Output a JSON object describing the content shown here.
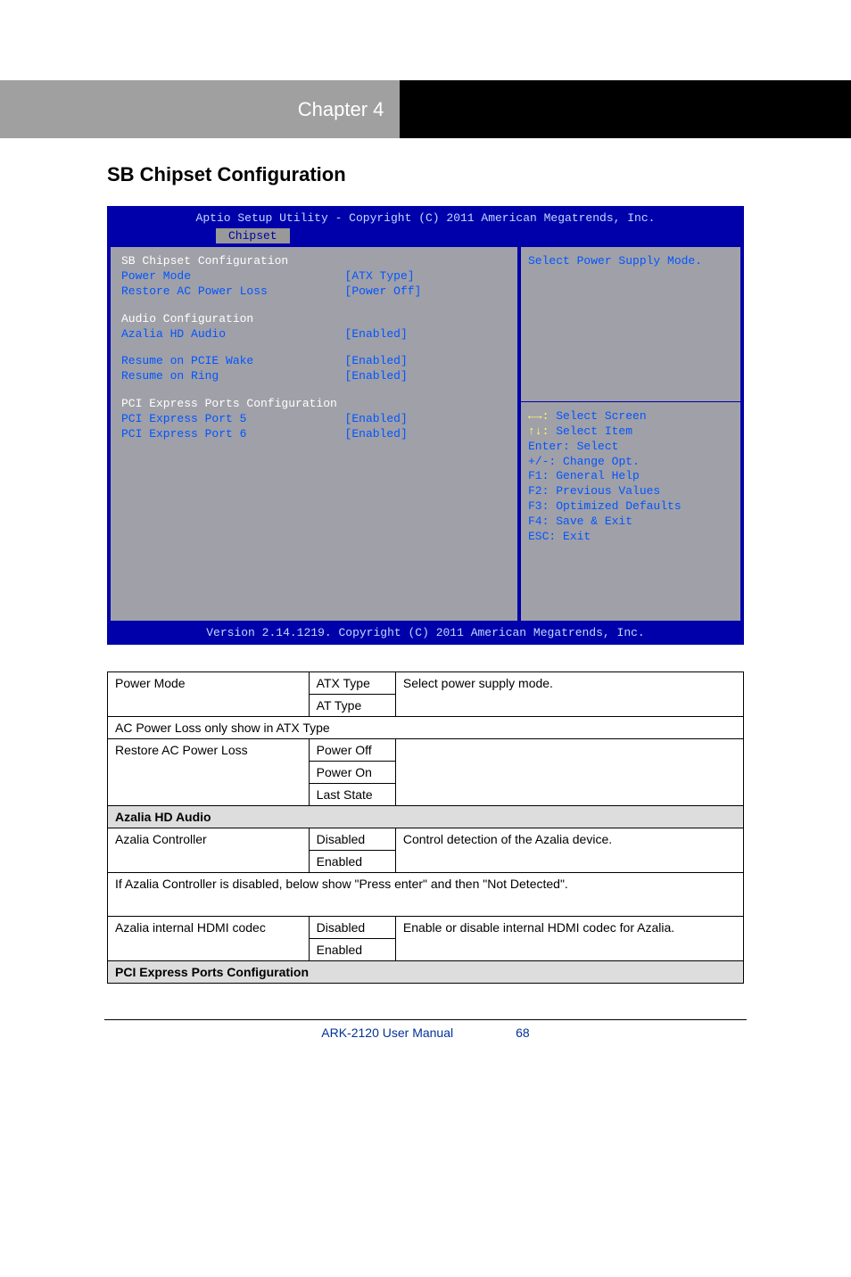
{
  "header": {
    "chapter": "Chapter 4"
  },
  "title": "SB Chipset Configuration",
  "bios": {
    "topline": "Aptio Setup Utility - Copyright (C) 2011 American Megatrends, Inc.",
    "tab": "Chipset",
    "sections": {
      "sb": "SB Chipset Configuration",
      "audio": "Audio Configuration",
      "pci": "PCI Express Ports Configuration"
    },
    "items": [
      {
        "label": "Power Mode",
        "value": "[ATX Type]"
      },
      {
        "label": "Restore AC Power Loss",
        "value": "[Power Off]"
      },
      {
        "label": "Azalia HD Audio",
        "value": "[Enabled]"
      },
      {
        "label": "Resume on PCIE Wake",
        "value": "[Enabled]"
      },
      {
        "label": "Resume on Ring",
        "value": "[Enabled]"
      },
      {
        "label": "PCI Express Port 5",
        "value": "[Enabled]"
      },
      {
        "label": "PCI Express Port 6",
        "value": "[Enabled]"
      }
    ],
    "help": "Select Power Supply Mode.",
    "keys": [
      {
        "k": "←→:",
        "t": "Select Screen"
      },
      {
        "k": "↑↓:",
        "t": "Select Item"
      },
      {
        "k": "Enter:",
        "t": "Select"
      },
      {
        "k": "+/-:",
        "t": "Change Opt."
      },
      {
        "k": "F1:",
        "t": "General Help"
      },
      {
        "k": "F2:",
        "t": "Previous Values"
      },
      {
        "k": "F3:",
        "t": "Optimized Defaults"
      },
      {
        "k": "F4:",
        "t": "Save & Exit"
      },
      {
        "k": "ESC:",
        "t": "Exit"
      }
    ],
    "bottomline": "Version 2.14.1219. Copyright (C) 2011 American Megatrends, Inc."
  },
  "table": [
    {
      "item": "Power Mode",
      "options": [
        "ATX Type",
        "AT Type"
      ],
      "desc": "Select power supply mode."
    },
    {
      "header": "AC Power Loss only show in ATX Type"
    },
    {
      "item": "Restore AC Power Loss",
      "options": [
        "Power Off",
        "Power On",
        "Last State"
      ],
      "desc": ""
    },
    {
      "header": "Azalia HD Audio"
    },
    {
      "item": "Azalia Controller",
      "options": [
        "Disabled",
        "Enabled"
      ],
      "desc": "Control detection of the Azalia device."
    },
    {
      "header": "If Azalia Controller is disabled, below show \"Press enter\" and then \"Not Detected\"."
    },
    {
      "item": "Azalia internal HDMI codec",
      "options": [
        "Disabled",
        "Enabled"
      ],
      "desc": "Enable or disable internal HDMI codec for Azalia."
    },
    {
      "header": "PCI Express Ports Configuration"
    }
  ],
  "footer": {
    "page": "68",
    "title": "ARK-2120 User Manual"
  }
}
